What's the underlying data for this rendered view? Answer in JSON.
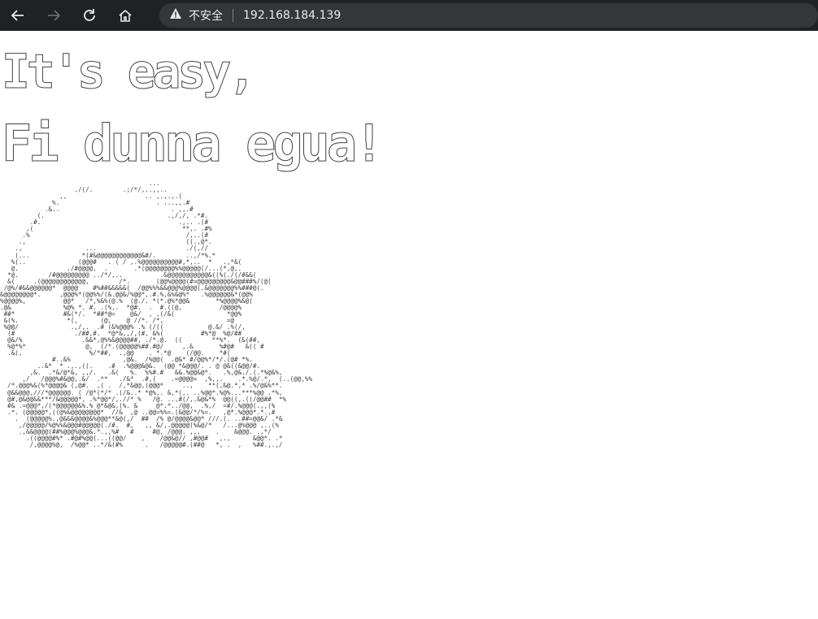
{
  "browser": {
    "back_icon": "arrow-left-icon",
    "forward_icon": "arrow-right-icon",
    "reload_icon": "reload-icon",
    "home_icon": "home-icon",
    "security_icon": "warning-triangle-icon",
    "security_label": "不安全",
    "url": "192.168.184.139"
  },
  "page": {
    "banner_line1": "It's easy,",
    "banner_line2": "Fi dunna egua!",
    "ascii_art": "                                        ...\n                    ./(/.        .;/*/,..,,..\n                ,,                     .. ,.,.,.(\n              %.                          . ...,,.#\n            .&..                              . ,,.#\n          (.                                 .,/,/, .*#.\n        .#.                                     .,.. .(#\n       ,(                                        **,. .#%\n      .%                                          /,..(#\n     .,                                           ((.,@*.\n    .,                 ...                        ./(,//\n    (...              *(#&@@@@@@@@@@@@&#/.        ..,/*%.*\n   %(..              (@@@#   . ( / ,.%@@@@@@@@@@#,*,..  *   .,*&(\n   @.             ./#@@@@,  .       .*(@@@@@@@@%%@@@@@(/...(*,@,.\n  *@.        /#@@@@@@@@@ ../*/,..          .&@@@@@@@@@@@&((%(./(/#&&(\n  &(     .(@@@@@@@@@@@@,        /*.       (@@%@@@@(#=@@@@@@@@@&@@###%/(@(\n /@%/#&&@@@@@@*  @@@@    #%##&&&&&(  /@@%%%&&@@@%@@@@(.&@@@@@@@%%###@(.\n&@@@@@@@@*.     ,@@@%*(@@%%/(&.@@&/%@@*,.#.%,&%&@%*   .%@@@@@@&*(@@%\n%@@@@%,          @@*   /*,%&%(@.%  (@./. *(*.@%*@@&       *%@@@@%&@(\n.@&              %@% *. #. .(%,.  *@#.  .  #.((@,          /@@@@%\n ##*             #&(*/.  *##*@=    @&/  , ,(/&(              *@@%\n &(%.             *(,      (@,    @ //*. /*,                 =@\n %@@/              .,/,.  .# (&%@@@% .% (/((            @.&/ .%(/,\n  (#                ./##,#.  *@*&,,/,(#, &%(          #%*@  %@/##\n  @&/%                .&&*,@%%&@@@@##, ./*.@.  ((        **%*.  (&(##,\n  %@*%*                @,  (/*.(@@@@@%##.#@/     ,.&       %#@#   &(( #\n  .&(,                  %/*##,  .,@@    . *.*@    (/@@.    *#(\n              #..&%              ,@&.  /%@@(  .@&* #/@@%*/*/.(@# *%.\n          ..&*  * .,.,((.    .#  .%@@@&@&.  (@@ *&@@@/. . @ @&((&@@/#.\n        ,&.  .*&/@*&, ,,/.   .&(   %.  %%#.#   &&.%@@&@*.   .%,@&./.(.*%@&%,\n      ,/   /@@@%#&@@,.&/  .**   ./&*  .#,(    .=@@@@=  ,%,,.    .*.%@/.*,  (..(@@,%%\n  /*.@@@%&(%*@@@@& (,@#.  ,( .  /,*&@@,(@@@*     ..,    **(,&@.*,* .%/@&%**.\n  @&&@@@,///*@@@@@@. ( /@*(*/* .(/&..* *@%,. &,*(,. ..%@@*.%@%...***%@@ .*%,\n  @#,@&@@&&***/&@@@@@*, .%*@@*/,.//* %   /@. ..,#(/,.&@&*%  @@((,.((/@@##  *%\n  #& .=@@@*,/(*@@@@@@&%.% @*&@&,(%. &     @*.*../@@,  .%,/  =#/.%@@@(.,,(%\n  .*. (@@@@@*,((@%&@@@@@@@@*  //&  ,@ ..@@=%%=.(&@@/*/%=.   ,@*.%@@@*.*.,#\n    .  (@@@@@%.,@&&&@@@@&%@@@**&@(,/  ##  /% @/@@@@&@@* ///.(. ..##=@@&/ .*&\n     ,/@@@@@/%@%%&@@@#@@@@@(./#.  #,   ,, &/,.@@@@@(%&@/*   /...@%@@@ ,..(%\n     .,&&@@@@(##%@@@%@@@&.*.,,%#   #     #@, /@@@. ,,.    .    &@@@. .,*/\n       .((@@@@#%* .#@#%@@(...((@@/    ,    /@@&@// ,#@@#   ,.,      &@@*. .*\n        /,@@@@%@,  /%@@* ..*/&(#%      .   /@@@@@#.(##@   *, .  ,   %##.,.,/"
  }
}
